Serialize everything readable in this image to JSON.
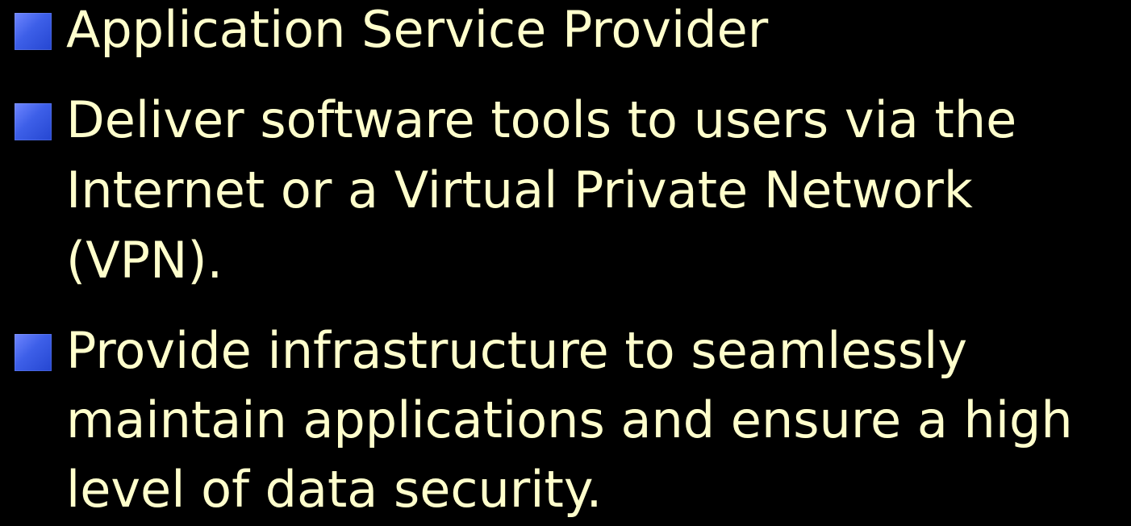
{
  "colors": {
    "background": "#000000",
    "text": "#FFFFCC",
    "bullet": "#3d5fe8"
  },
  "bullets": [
    {
      "lines": [
        "Application Service Provider"
      ]
    },
    {
      "lines": [
        "Deliver software tools to users via the",
        "Internet or a Virtual Private Network",
        "(VPN)."
      ]
    },
    {
      "lines": [
        "Provide infrastructure to seamlessly",
        "maintain applications and ensure a high",
        "level of data security."
      ]
    }
  ]
}
